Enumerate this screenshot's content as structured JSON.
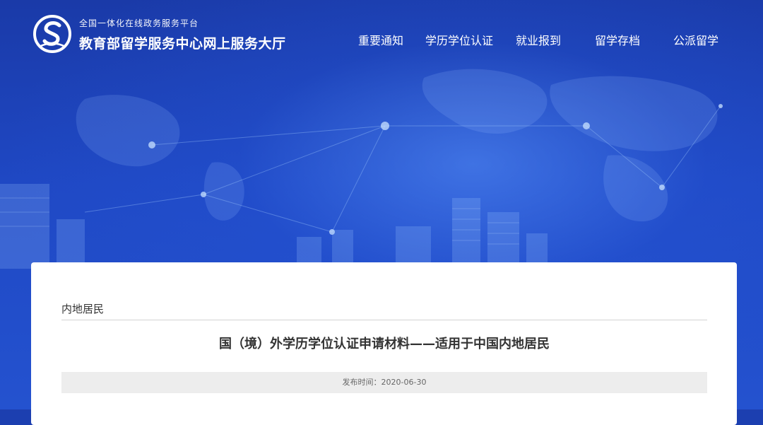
{
  "header": {
    "platform_sub": "全国一体化在线政务服务平台",
    "site_title": "教育部留学服务中心网上服务大厅"
  },
  "nav": {
    "items": [
      {
        "label": "重要通知"
      },
      {
        "label": "学历学位认证"
      },
      {
        "label": "就业报到"
      },
      {
        "label": "留学存档"
      },
      {
        "label": "公派留学"
      }
    ]
  },
  "article": {
    "category": "内地居民",
    "title": "国（境）外学历学位认证申请材料——适用于中国内地居民",
    "publish_label": "发布时间：",
    "publish_date": "2020-06-30"
  },
  "colors": {
    "hero_blue": "#1f48c4",
    "card_bg": "#ffffff",
    "meta_bar_bg": "#ededed"
  }
}
